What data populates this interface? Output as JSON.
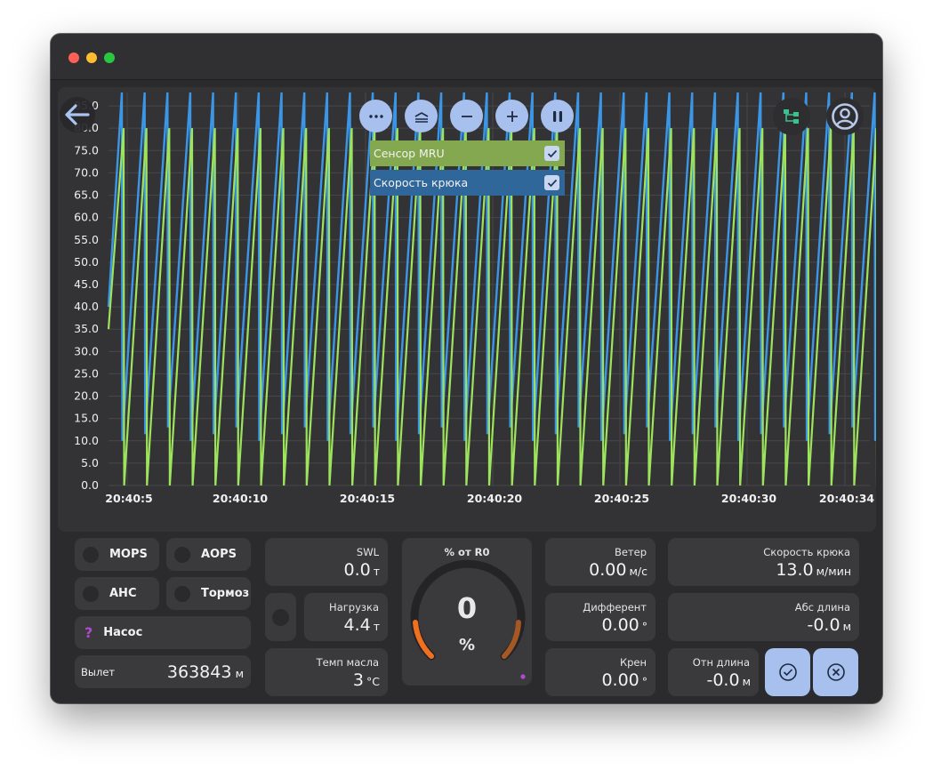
{
  "toolbar": {
    "icons": [
      "back-arrow-icon",
      "more-icon",
      "layers-icon",
      "zoom-out-icon",
      "zoom-in-icon",
      "pause-icon",
      "hierarchy-icon",
      "user-icon"
    ]
  },
  "legend": {
    "items": [
      {
        "label": "Сенсор MRU",
        "checked": true,
        "color": "#84a84f"
      },
      {
        "label": "Скорость крюка",
        "checked": true,
        "color": "#30679b"
      }
    ]
  },
  "chart_data": {
    "type": "line",
    "y_ticks": [
      "0.0",
      "5.0",
      "10.0",
      "15.0",
      "20.0",
      "25.0",
      "30.0",
      "35.0",
      "40.0",
      "45.0",
      "50.0",
      "55.0",
      "60.0",
      "65.0",
      "70.0",
      "75.0",
      "80.0",
      "85.0"
    ],
    "x_ticks": [
      "20:40:5",
      "20:40:10",
      "20:40:15",
      "20:40:20",
      "20:40:25",
      "20:40:30",
      "20:40:34"
    ],
    "ylim": [
      0,
      88
    ],
    "grid": true,
    "series": [
      {
        "name": "Сенсор MRU",
        "color": "#9ee35c",
        "shape": "sawtooth",
        "min": 0,
        "max": 80
      },
      {
        "name": "Скорость крюка",
        "color": "#3b96e6",
        "shape": "sawtooth",
        "min": 10,
        "max": 88
      }
    ]
  },
  "indicators": {
    "mops": "MOPS",
    "aops": "AOPS",
    "ahc": "AHC",
    "brake": "Тормоз",
    "pump": "Насос",
    "pump_icon": "?"
  },
  "reach": {
    "label": "Вылет",
    "value": "363843",
    "unit": "м"
  },
  "swl": {
    "title": "SWL",
    "value": "0.0",
    "unit": "т"
  },
  "load": {
    "title": "Нагрузка",
    "value": "4.4",
    "unit": "т"
  },
  "oil_temp": {
    "title": "Темп масла",
    "value": "3",
    "unit": "°C"
  },
  "gauge": {
    "title": "% от R0",
    "value": "0",
    "unit": "%",
    "fraction": 0.0,
    "low_color": "#f07020"
  },
  "wind": {
    "title": "Ветер",
    "value": "0.00",
    "unit": "м/с"
  },
  "trim": {
    "title": "Дифферент",
    "value": "0.00",
    "unit": "°"
  },
  "roll": {
    "title": "Крен",
    "value": "0.00",
    "unit": "°"
  },
  "hook_speed": {
    "title": "Скорость крюка",
    "value": "13.0",
    "unit": "м/мин"
  },
  "abs_length": {
    "title": "Абс длина",
    "value": "-0.0",
    "unit": "м"
  },
  "rel_length": {
    "title": "Отн длина",
    "value": "-0.0",
    "unit": "м"
  },
  "actions": {
    "confirm": "check-circle-icon",
    "cancel": "cancel-circle-icon"
  }
}
